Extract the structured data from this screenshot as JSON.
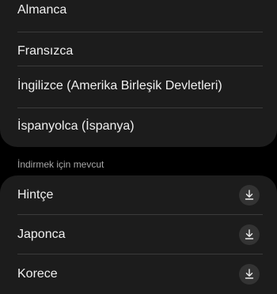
{
  "installed_languages": [
    {
      "label": "Almanca"
    },
    {
      "label": "Fransızca"
    },
    {
      "label": "İngilizce (Amerika Birleşik Devletleri)"
    },
    {
      "label": "İspanyolca (İspanya)"
    }
  ],
  "available_section": {
    "title": "İndirmek için mevcut",
    "items": [
      {
        "label": "Hintçe",
        "action_icon": "download-icon"
      },
      {
        "label": "Japonca",
        "action_icon": "download-icon"
      },
      {
        "label": "Korece",
        "action_icon": "download-icon"
      }
    ]
  }
}
